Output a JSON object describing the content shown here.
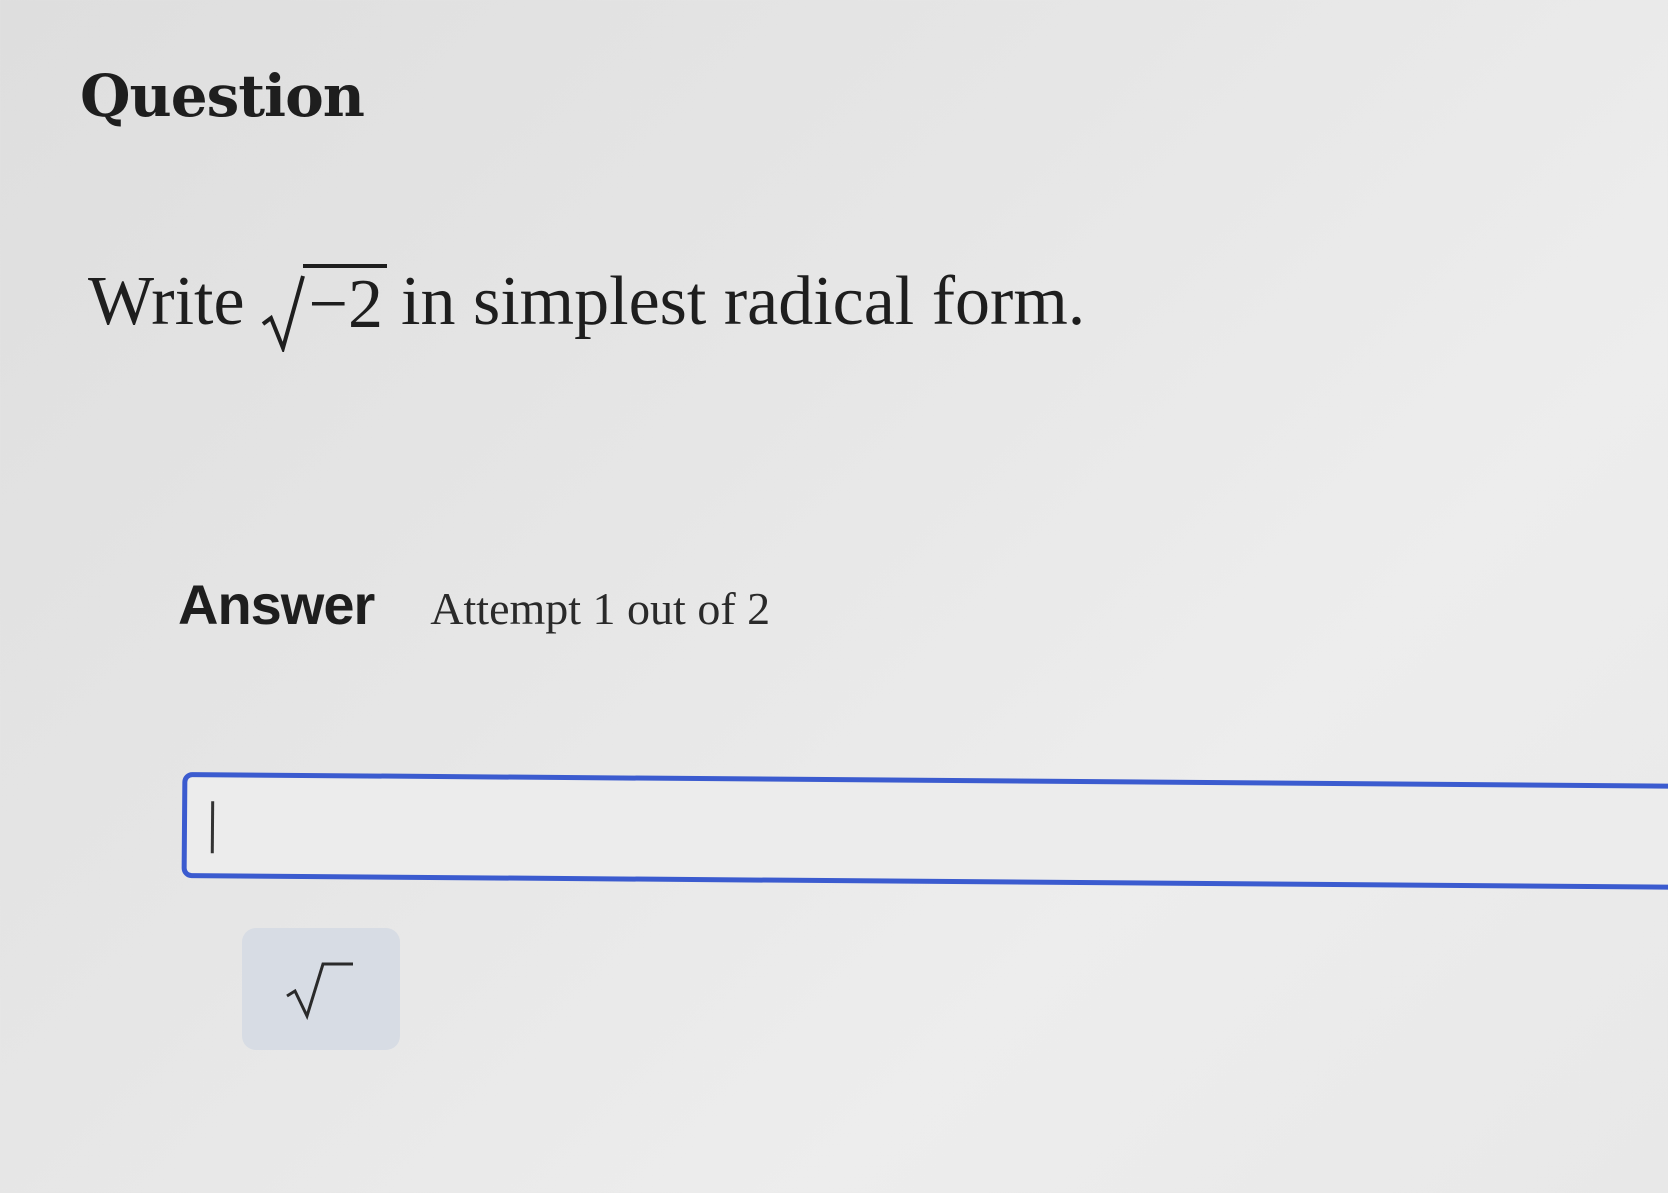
{
  "question": {
    "heading": "Question",
    "prompt_prefix": "Write",
    "radicand": "−2",
    "prompt_suffix": "in simplest radical form."
  },
  "answer": {
    "label": "Answer",
    "attempt_text": "Attempt 1 out of 2",
    "input_value": "",
    "accent_color": "#3b5bcf"
  },
  "toolbar": {
    "sqrt_button_icon": "square-root-icon"
  }
}
